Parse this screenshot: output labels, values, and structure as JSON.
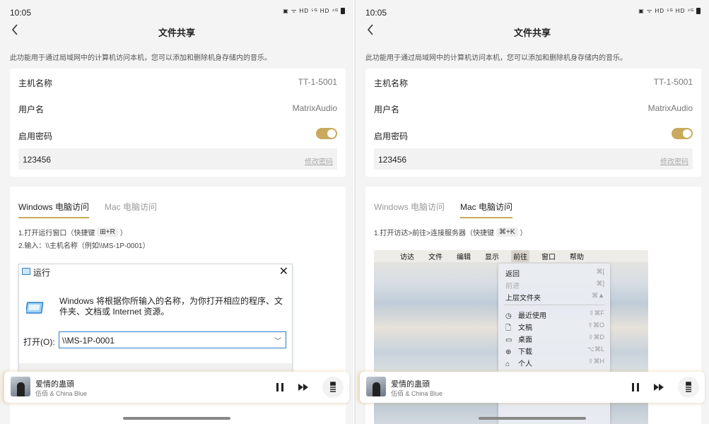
{
  "status": {
    "time": "10:05",
    "icons": "▣ ᯤ HD ⁵ᴳ HD ⁴ᴳ"
  },
  "header": {
    "title": "文件共享"
  },
  "description": "此功能用于通过局域网中的计算机访问本机，您可以添加和删除机身存储内的音乐。",
  "settings": {
    "host_label": "主机名称",
    "host_value": "TT-1-5001",
    "user_label": "用户名",
    "user_value": "MatrixAudio",
    "password_label": "启用密码",
    "password_enabled": true,
    "password_value": "123456",
    "change_password": "修改密码"
  },
  "tabs": {
    "windows": "Windows 电脑访问",
    "mac": "Mac 电脑访问"
  },
  "windows_steps": {
    "step1_prefix": "1.打开运行窗口（快捷键",
    "step1_key": "⊞+R",
    "step1_suffix": "）",
    "step2": "2.输入：\\\\主机名称（例如\\\\MS-1P-0001）"
  },
  "run_dialog": {
    "title": "运行",
    "description": "Windows 将根据你所输入的名称，为你打开相应的程序、文件夹、文档或 Internet 资源。",
    "open_label": "打开(O):",
    "input_value": "\\\\MS-1P-0001"
  },
  "mac_steps": {
    "step1_prefix": "1.打开访达>前往>连接服务器（快捷键",
    "step1_key": "⌘+K",
    "step1_suffix": "）"
  },
  "mac_menubar": [
    "访达",
    "文件",
    "编辑",
    "显示",
    "前往",
    "窗口",
    "帮助"
  ],
  "mac_menu": [
    {
      "label": "返回",
      "shortcut": "⌘[",
      "icon": ""
    },
    {
      "label": "前进",
      "shortcut": "⌘]",
      "icon": "",
      "disabled": true
    },
    {
      "label": "上层文件夹",
      "shortcut": "⌘▲",
      "icon": ""
    },
    {
      "label": "最近使用",
      "shortcut": "⇧⌘F",
      "icon": "◷"
    },
    {
      "label": "文稿",
      "shortcut": "⇧⌘O",
      "icon": "🗋"
    },
    {
      "label": "桌面",
      "shortcut": "⇧⌘D",
      "icon": "▭"
    },
    {
      "label": "下载",
      "shortcut": "⌥⌘L",
      "icon": "⊕"
    },
    {
      "label": "个人",
      "shortcut": "⇧⌘H",
      "icon": "⌂"
    }
  ],
  "player": {
    "song": "爱情的蛊頭",
    "artist": "伍佰 & China Blue"
  },
  "colors": {
    "accent": "#c9a95c"
  }
}
